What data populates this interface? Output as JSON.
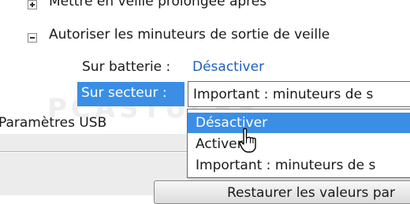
{
  "tree": {
    "clipped_item": "Mettre en veille prolongée après",
    "autoriser": "Autoriser les minuteurs de sortie de veille",
    "sur_batterie_label": "Sur batterie :",
    "sur_batterie_value": "Désactiver",
    "sur_secteur_label": "Sur secteur :",
    "sur_secteur_value": "Important : minuteurs de s",
    "usb": "Paramètres USB"
  },
  "dropdown": {
    "options": [
      {
        "label": "Désactiver",
        "selected": true
      },
      {
        "label": "Activer",
        "selected": false
      },
      {
        "label": "Important : minuteurs de s",
        "selected": false
      }
    ]
  },
  "restore_button": "Restaurer les valeurs par",
  "watermark": "PCASTUCES",
  "icons": {
    "expand": "plus-expander-icon",
    "collapse": "minus-collapser-icon",
    "cursor": "mouse-pointer-icon"
  },
  "colors": {
    "selection": "#3a8ee6",
    "link_value": "#1f5fbf"
  }
}
